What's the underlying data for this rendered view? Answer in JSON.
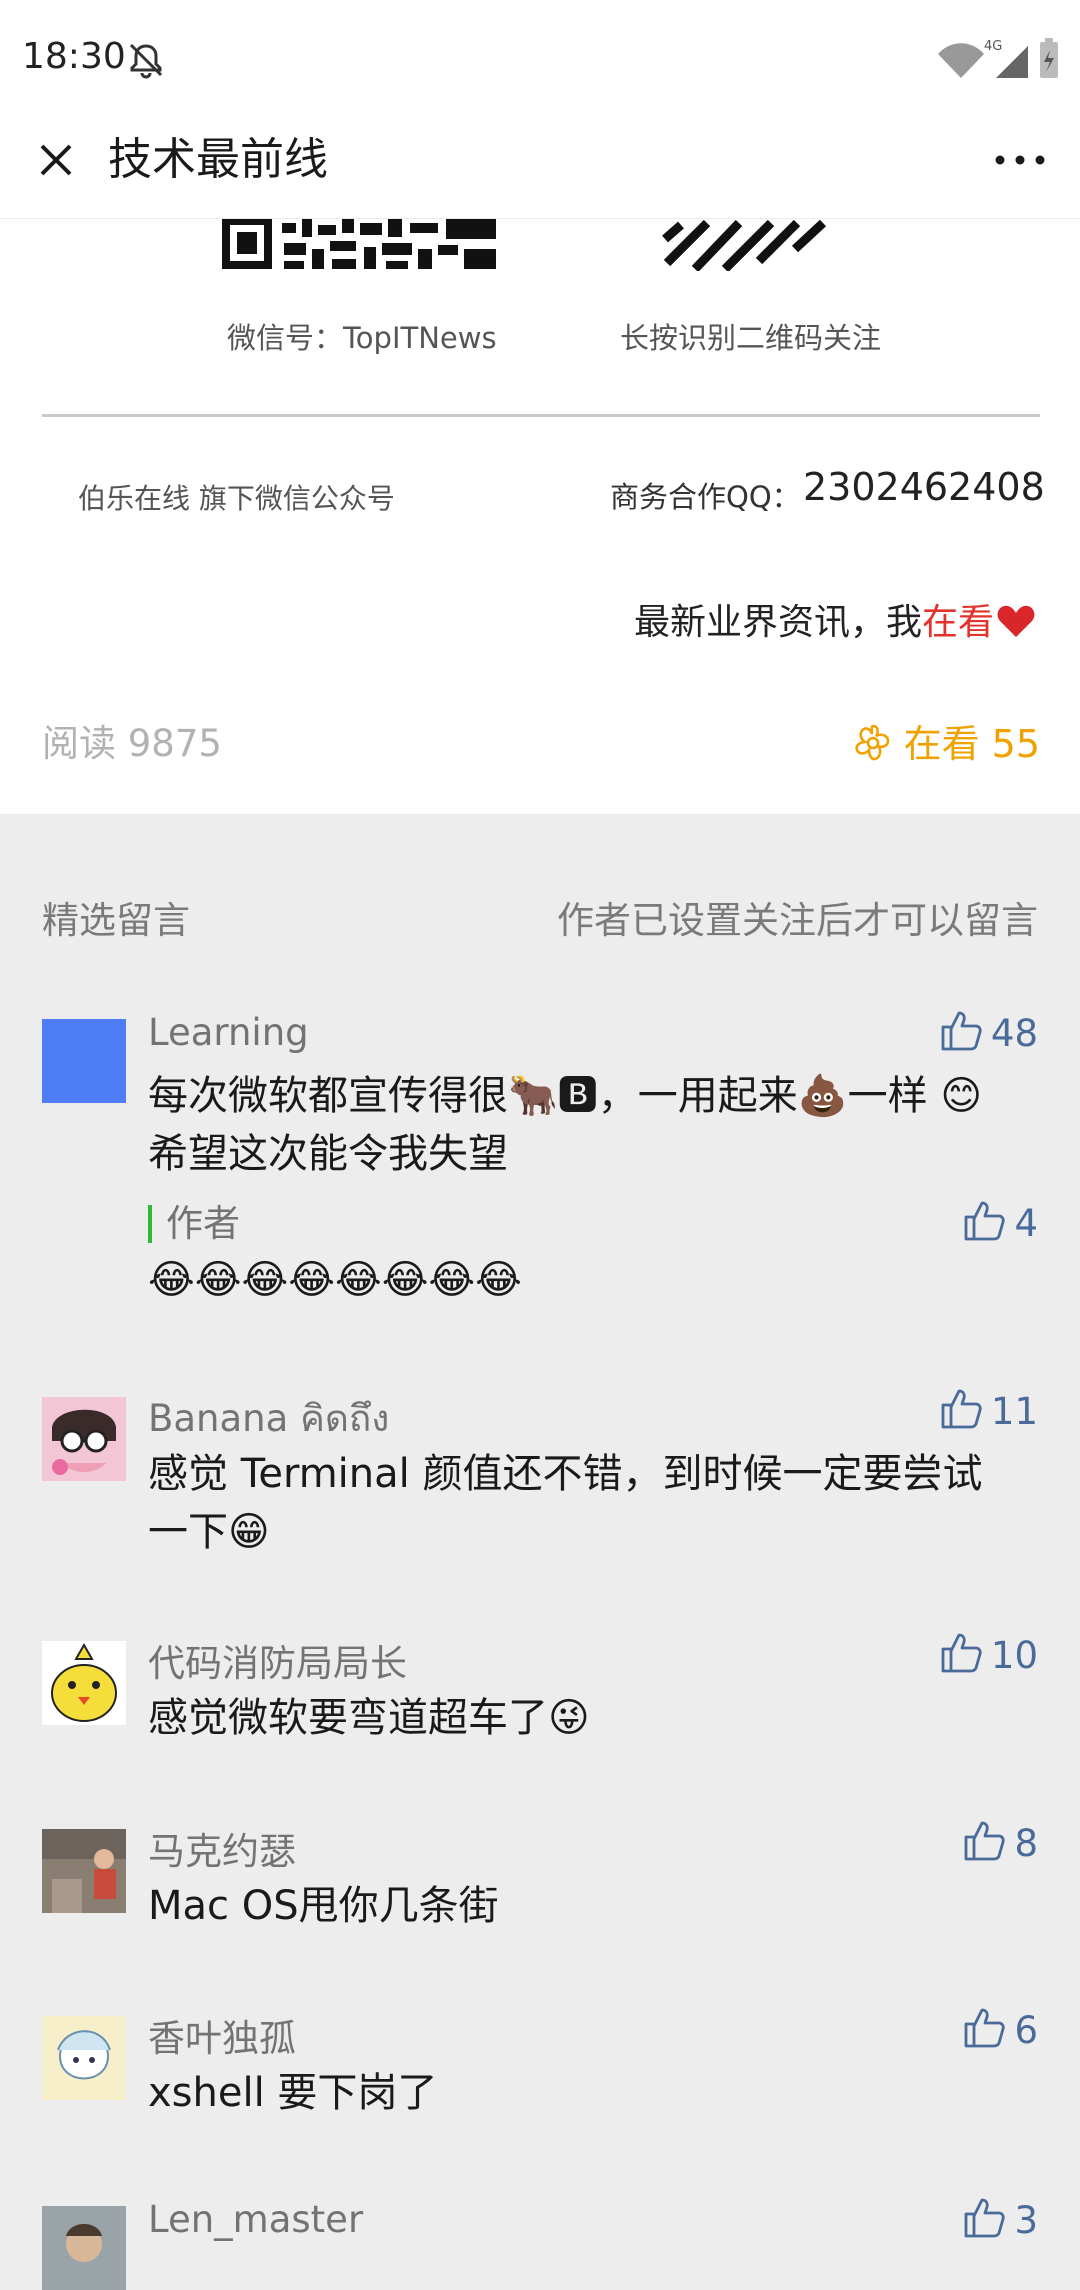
{
  "status": {
    "time": "18:30",
    "network": "4G"
  },
  "header": {
    "title": "技术最前线"
  },
  "article": {
    "qr_left_caption": "微信号：TopITNews",
    "qr_right_caption": "长按识别二维码关注",
    "org": "伯乐在线 旗下微信公众号",
    "business_label": "商务合作QQ：",
    "business_qq": "2302462408",
    "zaikan_prefix": "最新业界资讯，我",
    "zaikan_red": "在看",
    "read_label": "阅读 9875",
    "watching_label": "在看 55"
  },
  "comments_section": {
    "title": "精选留言",
    "notice": "作者已设置关注后才可以留言"
  },
  "comments": [
    {
      "nick": "Learning",
      "likes": "48",
      "text": "每次微软都宣传得很🐂🅱，一用起来💩一样 😊 希望这次能令我失望",
      "reply_label": "作者",
      "reply_likes": "4",
      "reply_text": "😂😂😂😂😂😂😂😂"
    },
    {
      "nick": "Banana คิดถึง",
      "likes": "11",
      "text": "感觉 Terminal 颜值还不错，到时候一定要尝试一下😁"
    },
    {
      "nick": "代码消防局局长",
      "likes": "10",
      "text": "感觉微软要弯道超车了😜"
    },
    {
      "nick": "马克约瑟",
      "likes": "8",
      "text": "Mac OS甩你几条街"
    },
    {
      "nick": "香叶独孤",
      "likes": "6",
      "text": "xshell 要下岗了"
    },
    {
      "nick": "Len_master",
      "likes": "3",
      "text": ""
    }
  ],
  "colors": {
    "accent_green": "#2cbb34",
    "like_blue": "#4a6b9a",
    "watch_gold": "#f0a300",
    "red": "#e3322c"
  },
  "icons": [
    "close-icon",
    "more-icon",
    "heart-icon",
    "flower-icon",
    "thumb-up-icon",
    "bell-off-icon",
    "wifi-icon",
    "signal-icon",
    "battery-icon"
  ]
}
